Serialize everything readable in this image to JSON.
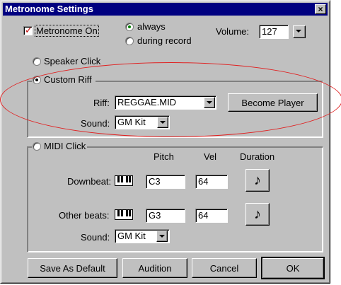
{
  "window": {
    "title": "Metronome Settings",
    "close": "×"
  },
  "metronome_on": {
    "label": "Metronome On",
    "checked": true
  },
  "when": {
    "always": "always",
    "during_record": "during record",
    "selected": "always"
  },
  "volume": {
    "label": "Volume:",
    "value": "127"
  },
  "speaker_click": {
    "label": "Speaker Click"
  },
  "custom_riff": {
    "label": "Custom Riff",
    "riff_label": "Riff:",
    "riff_value": "REGGAE.MID",
    "become_player": "Become Player",
    "sound_label": "Sound:",
    "sound_value": "GM Kit"
  },
  "midi_click": {
    "label": "MIDI Click",
    "headers": {
      "pitch": "Pitch",
      "vel": "Vel",
      "duration": "Duration"
    },
    "downbeat": {
      "label": "Downbeat:",
      "pitch": "C3",
      "vel": "64",
      "duration_icon": "eighth-note-icon"
    },
    "other_beats": {
      "label": "Other beats:",
      "pitch": "G3",
      "vel": "64",
      "duration_icon": "eighth-note-icon"
    },
    "sound_label": "Sound:",
    "sound_value": "GM Kit"
  },
  "buttons": {
    "save_default": "Save As Default",
    "audition": "Audition",
    "cancel": "Cancel",
    "ok": "OK"
  },
  "glyphs": {
    "note": "♪",
    "check": "✓"
  }
}
